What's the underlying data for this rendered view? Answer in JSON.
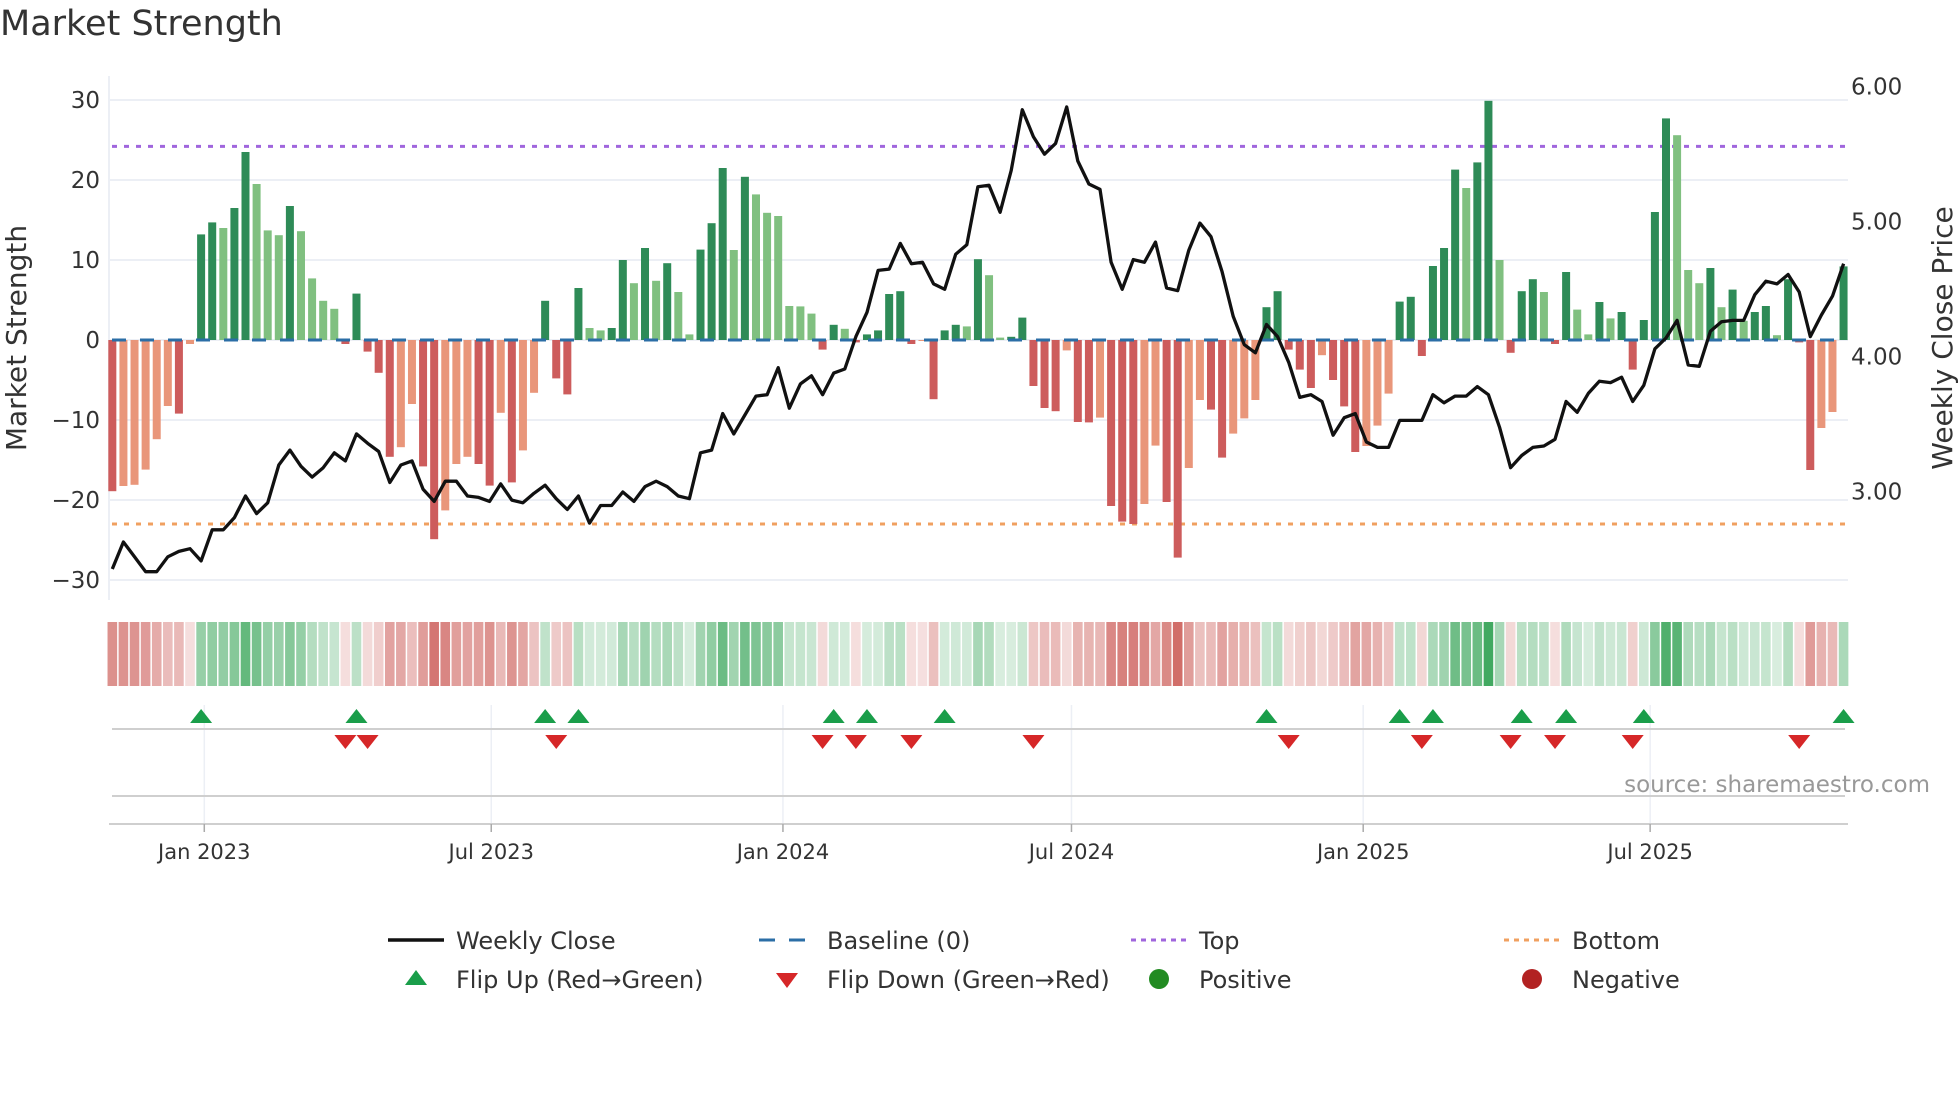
{
  "title": "Market Strength",
  "source": "source: sharemaestro.com",
  "colors": {
    "bar_pos_strong": "#2e8b57",
    "bar_pos_weak": "#80c080",
    "bar_neg_strong": "#cd5c5c",
    "bar_neg_weak": "#e9967a",
    "price_line": "#111111",
    "baseline": "#2b6ea6",
    "top_line": "#a066dd",
    "bottom_line": "#f0a060",
    "flip_up": "#1a9e4a",
    "flip_down": "#d62728",
    "positive": "#228b22",
    "negative": "#b22222"
  },
  "legend": [
    {
      "label": "Weekly Close",
      "icon": "solid-line"
    },
    {
      "label": "Baseline (0)",
      "icon": "dashed-line"
    },
    {
      "label": "Top",
      "icon": "dotted-line-purple"
    },
    {
      "label": "Bottom",
      "icon": "dotted-line-orange"
    },
    {
      "label": "Flip Up (Red→Green)",
      "icon": "triangle-up"
    },
    {
      "label": "Flip Down (Green→Red)",
      "icon": "triangle-down"
    },
    {
      "label": "Positive",
      "icon": "circle-green"
    },
    {
      "label": "Negative",
      "icon": "circle-red"
    }
  ],
  "chart_data": {
    "type": "bar",
    "title": "Market Strength",
    "ylabel": "Market Strength",
    "y2label": "Weekly Close Price",
    "ylim": [
      -32,
      32
    ],
    "y2lim": [
      2.22,
      6.01
    ],
    "yticks": [
      -30,
      -20,
      -10,
      0,
      10,
      20,
      30
    ],
    "ytick_labels": [
      "−30",
      "−20",
      "−10",
      "0",
      "10",
      "20",
      "30"
    ],
    "y2ticks": [
      3,
      4,
      5,
      6
    ],
    "y2tick_labels": [
      "3.00",
      "4.00",
      "5.00",
      "6.00"
    ],
    "first_week": "2022-11-04",
    "x_ticks": [
      {
        "label": "Jan 2023",
        "date": "2023-01-01"
      },
      {
        "label": "Jul 2023",
        "date": "2023-07-01"
      },
      {
        "label": "Jan 2024",
        "date": "2024-01-01"
      },
      {
        "label": "Jul 2024",
        "date": "2024-07-01"
      },
      {
        "label": "Jan 2025",
        "date": "2025-01-01"
      },
      {
        "label": "Jul 2025",
        "date": "2025-07-01"
      }
    ],
    "top_level": 24.2,
    "bottom_level": -23,
    "baseline": 0,
    "strength": [
      -18.9,
      -18.25,
      -18.1,
      -16.2,
      -12.4,
      -8.25,
      -9.2,
      -0.5,
      13.2,
      14.7,
      14.0,
      16.5,
      23.5,
      19.5,
      13.7,
      13.1,
      16.75,
      13.6,
      7.7,
      4.9,
      3.9,
      -0.5,
      5.8,
      -1.45,
      -4.1,
      -14.6,
      -13.4,
      -8.0,
      -15.8,
      -24.9,
      -21.3,
      -15.5,
      -14.6,
      -15.5,
      -18.2,
      -9.1,
      -17.8,
      -13.8,
      -6.6,
      4.9,
      -4.8,
      -6.8,
      6.5,
      1.5,
      1.2,
      1.5,
      10.0,
      7.1,
      11.5,
      7.4,
      9.6,
      6.0,
      0.7,
      11.3,
      14.6,
      21.5,
      11.25,
      20.4,
      18.2,
      15.9,
      15.5,
      4.25,
      4.2,
      3.3,
      -1.2,
      1.9,
      1.4,
      -0.3,
      0.7,
      1.2,
      5.75,
      6.1,
      -0.5,
      -0.1,
      -7.4,
      1.2,
      1.9,
      1.7,
      10.1,
      8.1,
      0.3,
      0.4,
      2.8,
      -5.75,
      -8.5,
      -8.9,
      -1.3,
      -10.25,
      -10.3,
      -9.7,
      -20.75,
      -22.7,
      -23.0,
      -20.5,
      -13.2,
      -20.25,
      -27.2,
      -16.0,
      -7.5,
      -8.7,
      -14.7,
      -11.7,
      -9.8,
      -7.5,
      4.1,
      6.1,
      -1.2,
      -3.7,
      -6.0,
      -1.9,
      -5.0,
      -8.3,
      -14.0,
      -13.25,
      -10.7,
      -6.7,
      4.8,
      5.4,
      -2.0,
      9.25,
      11.5,
      21.3,
      19.0,
      22.2,
      29.9,
      10.0,
      -1.6,
      6.1,
      7.6,
      6.0,
      -0.5,
      8.5,
      3.8,
      0.7,
      4.75,
      2.7,
      3.5,
      -3.7,
      2.5,
      16.0,
      27.7,
      25.6,
      8.75,
      7.1,
      9.0,
      4.1,
      6.3,
      2.4,
      3.5,
      4.25,
      0.6,
      7.6,
      -0.3,
      -16.25,
      -11.0,
      -9.0,
      9.2
    ],
    "weekly_close": [
      2.42,
      2.62,
      2.51,
      2.4,
      2.4,
      2.51,
      2.55,
      2.57,
      2.48,
      2.71,
      2.71,
      2.8,
      2.96,
      2.83,
      2.91,
      3.19,
      3.3,
      3.18,
      3.1,
      3.17,
      3.28,
      3.22,
      3.42,
      3.35,
      3.29,
      3.06,
      3.19,
      3.22,
      3.01,
      2.92,
      3.07,
      3.07,
      2.96,
      2.95,
      2.92,
      3.05,
      2.93,
      2.91,
      2.98,
      3.04,
      2.94,
      2.86,
      2.96,
      2.76,
      2.89,
      2.89,
      2.99,
      2.92,
      3.03,
      3.07,
      3.03,
      2.96,
      2.94,
      3.28,
      3.3,
      3.57,
      3.42,
      3.56,
      3.7,
      3.71,
      3.91,
      3.61,
      3.79,
      3.85,
      3.71,
      3.87,
      3.9,
      4.14,
      4.32,
      4.63,
      4.64,
      4.83,
      4.68,
      4.69,
      4.53,
      4.49,
      4.75,
      4.82,
      5.25,
      5.26,
      5.06,
      5.37,
      5.82,
      5.62,
      5.49,
      5.57,
      5.84,
      5.44,
      5.27,
      5.23,
      4.69,
      4.49,
      4.71,
      4.69,
      4.84,
      4.5,
      4.48,
      4.78,
      4.98,
      4.88,
      4.62,
      4.29,
      4.08,
      4.02,
      4.23,
      4.14,
      3.95,
      3.69,
      3.71,
      3.66,
      3.41,
      3.54,
      3.57,
      3.36,
      3.32,
      3.32,
      3.52,
      3.52,
      3.52,
      3.71,
      3.65,
      3.7,
      3.7,
      3.77,
      3.71,
      3.47,
      3.17,
      3.26,
      3.32,
      3.33,
      3.38,
      3.66,
      3.58,
      3.72,
      3.81,
      3.8,
      3.84,
      3.66,
      3.78,
      4.05,
      4.13,
      4.26,
      3.93,
      3.92,
      4.18,
      4.25,
      4.26,
      4.26,
      4.45,
      4.55,
      4.53,
      4.6,
      4.47,
      4.14,
      4.3,
      4.44,
      4.68
    ],
    "flip_up_weeks": [
      8,
      22,
      39,
      42,
      65,
      68,
      75,
      104,
      116,
      119,
      127,
      131,
      138,
      156
    ],
    "flip_down_weeks": [
      21,
      23,
      40,
      64,
      67,
      72,
      83,
      106,
      118,
      126,
      130,
      137,
      152
    ],
    "grid": true,
    "legend_position": "bottom"
  }
}
